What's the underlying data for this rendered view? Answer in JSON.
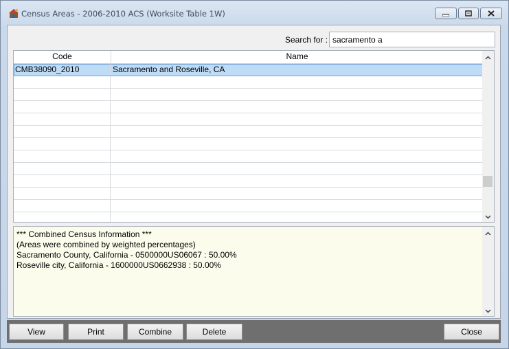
{
  "window": {
    "title": "Census Areas - 2006-2010 ACS (Worksite Table 1W)",
    "controls": {
      "minimize_icon": "minimize-icon",
      "restore_icon": "restore-icon",
      "close_icon": "close-icon"
    }
  },
  "search": {
    "label": "Search for :",
    "value": "sacramento a"
  },
  "grid": {
    "columns": [
      "Code",
      "Name"
    ],
    "rows": [
      {
        "code": "CMB38090_2010",
        "name": "Sacramento and Roseville, CA",
        "selected": true
      }
    ],
    "scroll_position": 0.83
  },
  "info": {
    "lines": [
      "*** Combined Census Information ***",
      "(Areas were combined by weighted percentages)",
      "Sacramento County, California - 0500000US06067 : 50.00%",
      "Roseville city, California - 1600000US0662938 : 50.00%"
    ]
  },
  "buttons": {
    "view": "View",
    "print": "Print",
    "combine": "Combine",
    "delete": "Delete",
    "close": "Close"
  },
  "colors": {
    "selection": "#bfdcf7",
    "info_background": "#fcfcec",
    "button_bar": "#6f6f6f"
  }
}
